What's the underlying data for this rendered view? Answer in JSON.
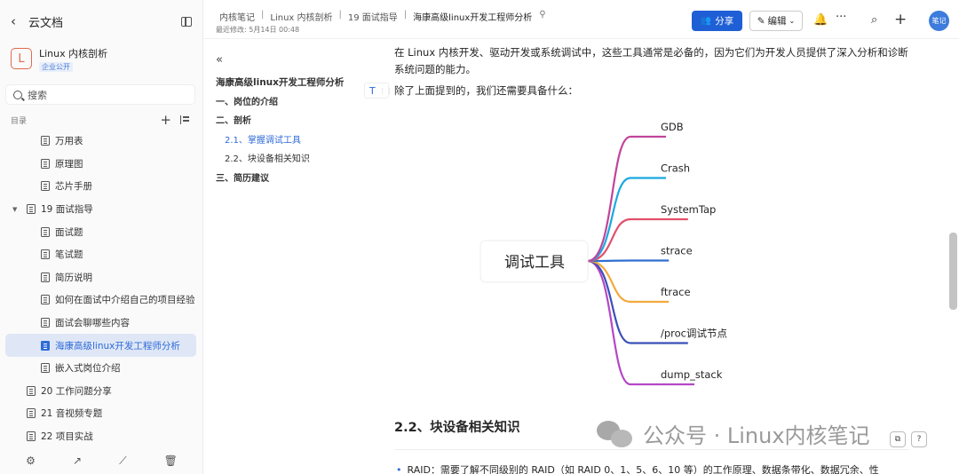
{
  "sidebar": {
    "back_label": "云文档",
    "kb_logo": "L",
    "kb_name": "Linux 内核剖析",
    "kb_badge": "企业公开",
    "search_placeholder": "搜索",
    "toc_label": "目录",
    "items": [
      {
        "label": "万用表",
        "level": 2
      },
      {
        "label": "原理图",
        "level": 2
      },
      {
        "label": "芯片手册",
        "level": 2
      },
      {
        "label": "19 面试指导",
        "level": 1,
        "expanded": true
      },
      {
        "label": "面试题",
        "level": 2
      },
      {
        "label": "笔试题",
        "level": 2
      },
      {
        "label": "简历说明",
        "level": 2
      },
      {
        "label": "如何在面试中介绍自己的项目经验",
        "level": 2
      },
      {
        "label": "面试会聊哪些内容",
        "level": 2
      },
      {
        "label": "海康高级linux开发工程师分析",
        "level": 2,
        "active": true
      },
      {
        "label": "嵌入式岗位介绍",
        "level": 2
      },
      {
        "label": "20 工作问题分享",
        "level": 1
      },
      {
        "label": "21 音视频专题",
        "level": 1
      },
      {
        "label": "22 项目实战",
        "level": 1
      }
    ],
    "bottom_icons": [
      "settings-icon",
      "share-icon",
      "chart-icon",
      "trash-icon"
    ]
  },
  "header": {
    "breadcrumbs": [
      "内核笔记",
      "Linux 内核剖析",
      "19 面试指导",
      "海康高级linux开发工程师分析"
    ],
    "last_modified": "最近修改: 5月14日 00:48",
    "share_label": "分享",
    "edit_label": "编辑",
    "avatar_text": "笔记"
  },
  "outline": {
    "title": "海康高级linux开发工程师分析",
    "items": [
      {
        "label": "一、岗位的介绍",
        "bold": true
      },
      {
        "label": "二、剖析",
        "bold": true
      },
      {
        "label": "2.1、掌握调试工具",
        "sub": true,
        "active": true
      },
      {
        "label": "2.2、块设备相关知识",
        "sub": true
      },
      {
        "label": "三、简历建议",
        "bold": true
      }
    ]
  },
  "content": {
    "paragraph1": "在 Linux 内核开发、驱动开发或系统调试中，这些工具通常是必备的，因为它们为开发人员提供了深入分析和诊断系统问题的能力。",
    "paragraph2": "除了上面提到的，我们还需要具备什么：",
    "mindmap": {
      "root": "调试工具",
      "branches": [
        {
          "label": "GDB",
          "color": "#c2449a"
        },
        {
          "label": "Crash",
          "color": "#1aa8e0"
        },
        {
          "label": "SystemTap",
          "color": "#e2506a"
        },
        {
          "label": "strace",
          "color": "#2f6fd0"
        },
        {
          "label": "ftrace",
          "color": "#f2a93b"
        },
        {
          "label": "/proc调试节点",
          "color": "#3b4fb8"
        },
        {
          "label": "dump_stack",
          "color": "#b447c6"
        }
      ]
    },
    "heading": "2.2、块设备相关知识",
    "bullet": "RAID：需要了解不同级别的 RAID（如 RAID 0、1、5、6、10 等）的工作原理、数据条带化、数据冗余、性"
  },
  "watermark": "公众号 · Linux内核笔记"
}
